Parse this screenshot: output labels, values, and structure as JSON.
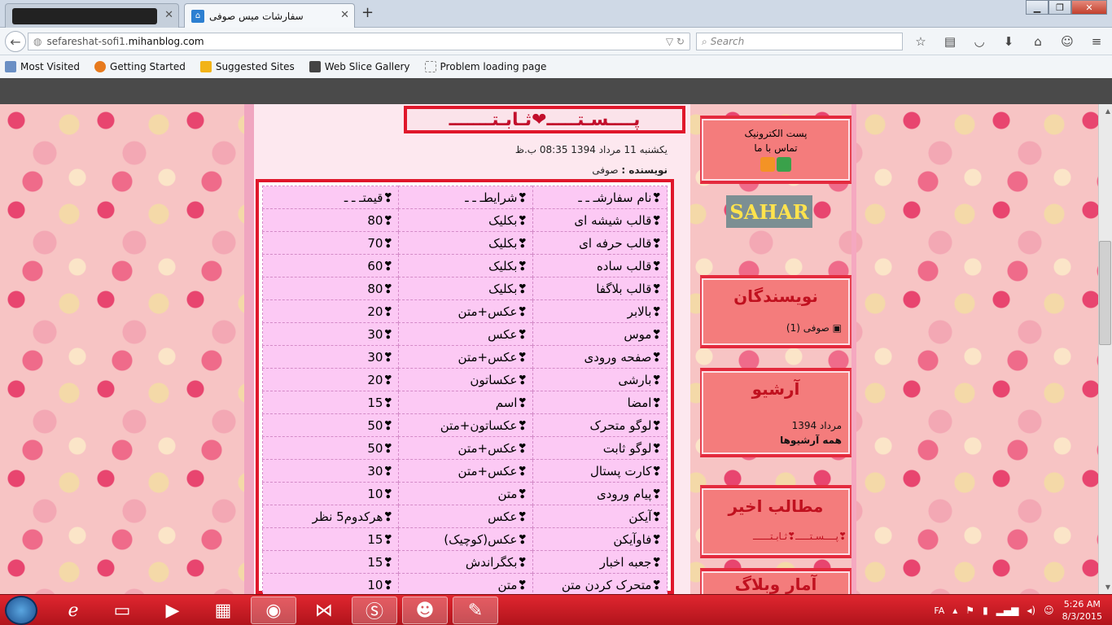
{
  "browser": {
    "tabs": [
      {
        "title": "",
        "blurred": true
      },
      {
        "title": "سفارشات میس صوفی",
        "active": true
      }
    ],
    "new_tab": "+",
    "url_prefix": "sefareshat-sofi1.",
    "url_domain": "mihanblog.com",
    "search_placeholder": "Search",
    "bookmarks": [
      "Most Visited",
      "Getting Started",
      "Suggested Sites",
      "Web Slice Gallery",
      "Problem loading page"
    ]
  },
  "post": {
    "title": "پــــسـتـــــ❤ثـابـتـــــــ",
    "meta": "یکشنبه 11 مرداد 1394 08:35 ب.ظ",
    "author_label": "نویسنده :",
    "author": "صوفی",
    "table": [
      [
        "❣نام سفارشـ ـ ـ",
        "❣شرایطـ ـ ـ",
        "❣قیمتـ ـ ـ"
      ],
      [
        "❣قالب شیشه ای",
        "❣بکلیک",
        "❣80"
      ],
      [
        "❣قالب حرفه ای",
        "❣بکلیک",
        "❣70"
      ],
      [
        "❣قالب ساده",
        "❣بکلیک",
        "❣60"
      ],
      [
        "❣قالب بلاگفا",
        "❣بکلیک",
        "❣80"
      ],
      [
        "❣بالابر",
        "❣عکس+متن",
        "❣20"
      ],
      [
        "❣موس",
        "❣عکس",
        "❣30"
      ],
      [
        "❣صفحه ورودی",
        "❣عکس+متن",
        "❣30"
      ],
      [
        "❣بارشی",
        "❣عکساتون",
        "❣20"
      ],
      [
        "❣امضا",
        "❣اسم",
        "❣15"
      ],
      [
        "❣لوگو متحرک",
        "❣عکساتون+متن",
        "❣50"
      ],
      [
        "❣لوگو ثابت",
        "❣عکس+متن",
        "❣50"
      ],
      [
        "❣کارت پستال",
        "❣عکس+متن",
        "❣30"
      ],
      [
        "❣پیام ورودی",
        "❣متن",
        "❣10"
      ],
      [
        "❣آیکن",
        "❣عکس",
        "❣هرکدوم5 نظر"
      ],
      [
        "❣فاوآیکن",
        "❣عکس(کوچیک)",
        "❣15"
      ],
      [
        "❣جعبه اخبار",
        "❣بکگراندش",
        "❣15"
      ],
      [
        "❣متحرک کردن متن",
        "❣متن",
        "❣10"
      ]
    ]
  },
  "sidebar": {
    "contact_line1": "پست الکترونیک",
    "contact_line2": "تماس با ما",
    "sahar": "SAHAR",
    "authors_title": "نویسندگان",
    "authors_item": "صوفی (1)",
    "archive_title": "آرشیو",
    "archive_month": "مرداد 1394",
    "archive_all": "همه آرشیوها",
    "recent_title": "مطالب اخیر",
    "recent_item": "❣پــــسـتـــــ❣ثـابـتــــــ",
    "stats_title": "آمار وبلاگ"
  },
  "taskbar": {
    "lang": "FA",
    "time": "5:26 AM",
    "date": "8/3/2015"
  }
}
